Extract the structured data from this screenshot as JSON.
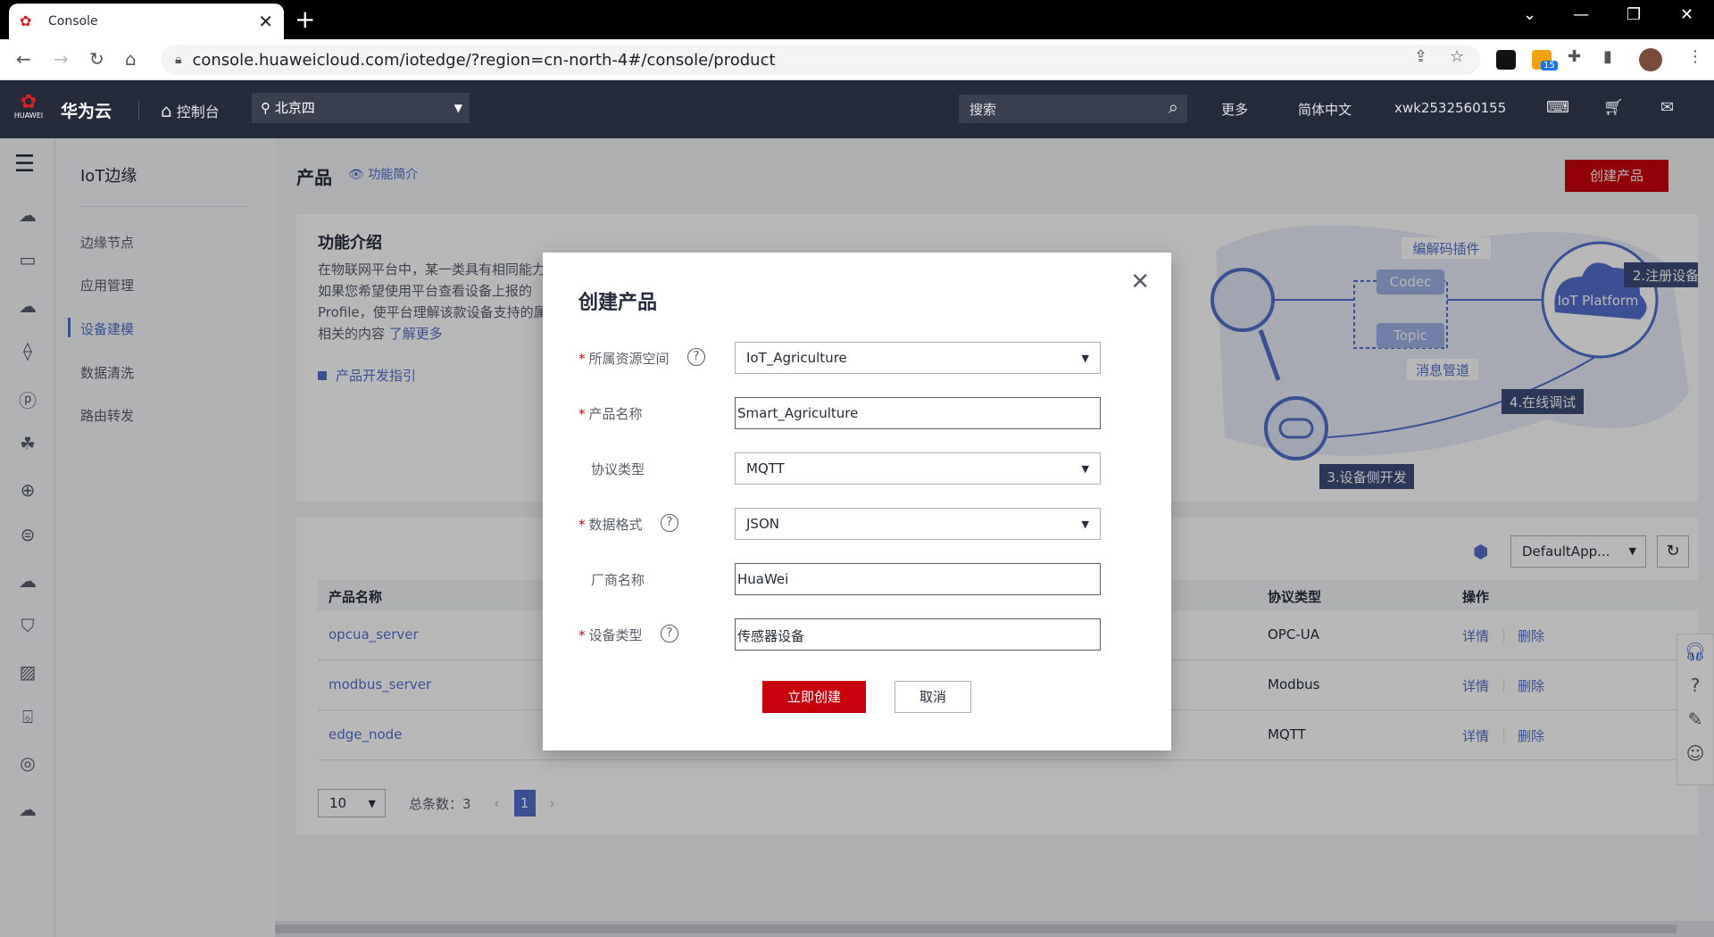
{
  "browser": {
    "tab_title": "Console",
    "url": "console.huaweicloud.com/iotedge/?region=cn-north-4#/console/product",
    "ext_badge": "15"
  },
  "header": {
    "logo_text": "HUAWEI",
    "brand": "华为云",
    "console": "控制台",
    "region": "北京四",
    "search_placeholder": "搜索",
    "more": "更多",
    "language": "简体中文",
    "user": "xwk2532560155"
  },
  "sidenav": {
    "title": "IoT边缘",
    "items": [
      {
        "label": "边缘节点"
      },
      {
        "label": "应用管理"
      },
      {
        "label": "设备建模"
      },
      {
        "label": "数据清洗"
      },
      {
        "label": "路由转发"
      }
    ]
  },
  "page": {
    "title": "产品",
    "intro_link": "功能简介",
    "create_button": "创建产品"
  },
  "intro": {
    "title": "功能介绍",
    "text": "在物联网平台中，某一类具有相同能力 如果您希望使用平台查看设备上报的 Profile，使平台理解该款设备支持的属 相关的内容",
    "learn_more": "了解更多",
    "guide": "产品开发指引",
    "diagram": {
      "codec_plugin": "编解码插件",
      "codec": "Codec",
      "topic": "Topic",
      "msg_pipe": "消息管道",
      "platform": "IoT Platform",
      "step2": "2.注册设备",
      "step3": "3.设备侧开发",
      "step4": "4.在线调试"
    }
  },
  "table": {
    "app_select": "DefaultApp...",
    "headers": [
      "产品名称",
      "协议类型",
      "操作"
    ],
    "rows": [
      {
        "name": "opcua_server",
        "protocol": "OPC-UA",
        "detail": "详情",
        "delete": "删除"
      },
      {
        "name": "modbus_server",
        "protocol": "Modbus",
        "detail": "详情",
        "delete": "删除"
      },
      {
        "name": "edge_node",
        "protocol": "MQTT",
        "detail": "详情",
        "delete": "删除"
      }
    ],
    "page_size": "10",
    "total": "总条数：3",
    "current_page": "1"
  },
  "modal": {
    "title": "创建产品",
    "fields": {
      "resource_space": {
        "label": "所属资源空间",
        "value": "IoT_Agriculture"
      },
      "product_name": {
        "label": "产品名称",
        "value": "Smart_Agriculture"
      },
      "protocol": {
        "label": "协议类型",
        "value": "MQTT"
      },
      "data_format": {
        "label": "数据格式",
        "value": "JSON"
      },
      "vendor": {
        "label": "厂商名称",
        "value": "HuaWei"
      },
      "device_type": {
        "label": "设备类型",
        "value": "传感器设备"
      }
    },
    "submit": "立即创建",
    "cancel": "取消"
  },
  "colors": {
    "brand_red": "#c7000b",
    "link_blue": "#526ecc",
    "header_bg": "#252b3a"
  }
}
